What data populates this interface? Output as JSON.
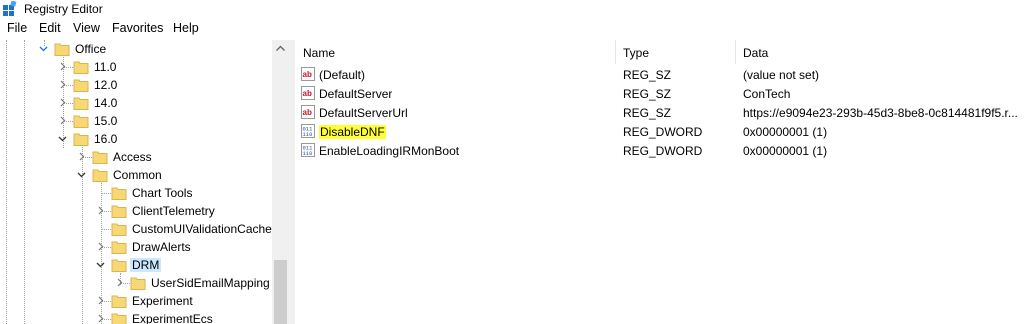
{
  "window": {
    "title": "Registry Editor"
  },
  "menu": [
    "File",
    "Edit",
    "View",
    "Favorites",
    "Help"
  ],
  "tree": {
    "items": [
      {
        "label": "Office",
        "expanded": true
      },
      {
        "label": "11.0",
        "expanded": false
      },
      {
        "label": "12.0",
        "expanded": false
      },
      {
        "label": "14.0",
        "expanded": false
      },
      {
        "label": "15.0",
        "expanded": false
      },
      {
        "label": "16.0",
        "expanded": true
      },
      {
        "label": "Access",
        "expanded": false
      },
      {
        "label": "Common",
        "expanded": true
      },
      {
        "label": "Chart Tools"
      },
      {
        "label": "ClientTelemetry",
        "expanded": false
      },
      {
        "label": "CustomUIValidationCache"
      },
      {
        "label": "DrawAlerts",
        "expanded": false
      },
      {
        "label": "DRM",
        "expanded": true,
        "selected": true
      },
      {
        "label": "UserSidEmailMapping",
        "expanded": false
      },
      {
        "label": "Experiment",
        "expanded": false
      },
      {
        "label": "ExperimentEcs",
        "expanded": false
      }
    ]
  },
  "list": {
    "columns": [
      "Name",
      "Type",
      "Data"
    ],
    "rows": [
      {
        "icon": "string-value-icon",
        "name": "(Default)",
        "type": "REG_SZ",
        "data": "(value not set)"
      },
      {
        "icon": "string-value-icon",
        "name": "DefaultServer",
        "type": "REG_SZ",
        "data": "ConTech"
      },
      {
        "icon": "string-value-icon",
        "name": "DefaultServerUrl",
        "type": "REG_SZ",
        "data": "https://e9094e23-293b-45d3-8be8-0c814481f9f5.r..."
      },
      {
        "icon": "binary-value-icon",
        "name": "DisableDNF",
        "type": "REG_DWORD",
        "data": "0x00000001 (1)",
        "highlighted": true
      },
      {
        "icon": "binary-value-icon",
        "name": "EnableLoadingIRMonBoot",
        "type": "REG_DWORD",
        "data": "0x00000001 (1)"
      }
    ]
  },
  "colors": {
    "selection": "#cce8ff",
    "highlight": "#ffff33",
    "folder": "#f8d775"
  }
}
